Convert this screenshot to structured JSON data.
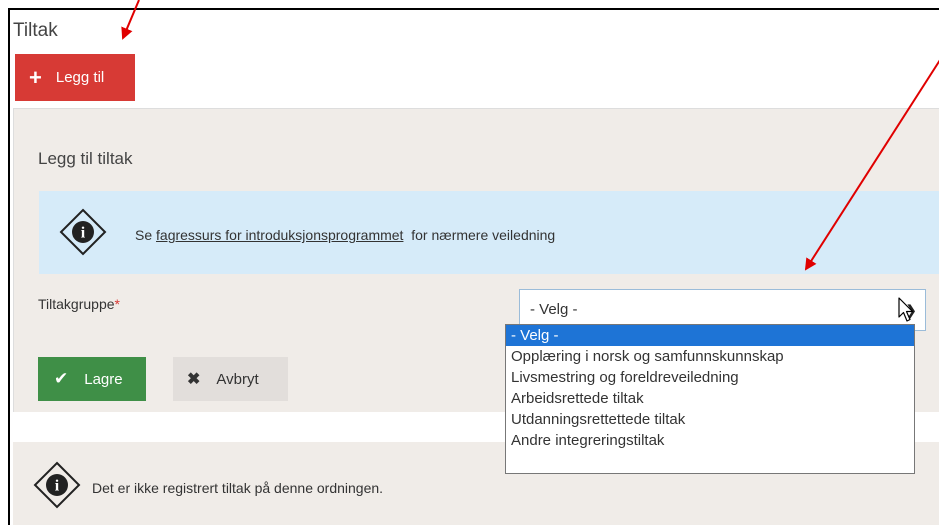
{
  "section": {
    "title": "Tiltak"
  },
  "add_button": {
    "icon": "plus-icon",
    "label": "Legg til"
  },
  "panel": {
    "title": "Legg til tiltak",
    "info": {
      "icon": "info-icon",
      "prefix": "Se",
      "link": "fagressurs for introduksjonsprogrammet",
      "suffix": "for nærmere veiledning"
    },
    "field": {
      "label": "Tiltakgruppe",
      "required_mark": "*",
      "selected": "- Velg -",
      "options": [
        "- Velg -",
        "Opplæring i norsk og samfunnskunnskap",
        "Livsmestring og foreldreveiledning",
        "Arbeidsrettede tiltak",
        "Utdanningsrettettede tiltak",
        "Andre integreringstiltak"
      ]
    },
    "save_label": "Lagre",
    "cancel_label": "Avbryt"
  },
  "status": {
    "icon": "info-icon",
    "text": "Det er ikke registrert tiltak på denne ordningen."
  },
  "colors": {
    "danger": "#d73a35",
    "success": "#3f8f47",
    "info_bg": "#d6ebf9",
    "panel_bg": "#f0ece8",
    "highlight": "#1e74d6",
    "annotation": "#e00000"
  }
}
